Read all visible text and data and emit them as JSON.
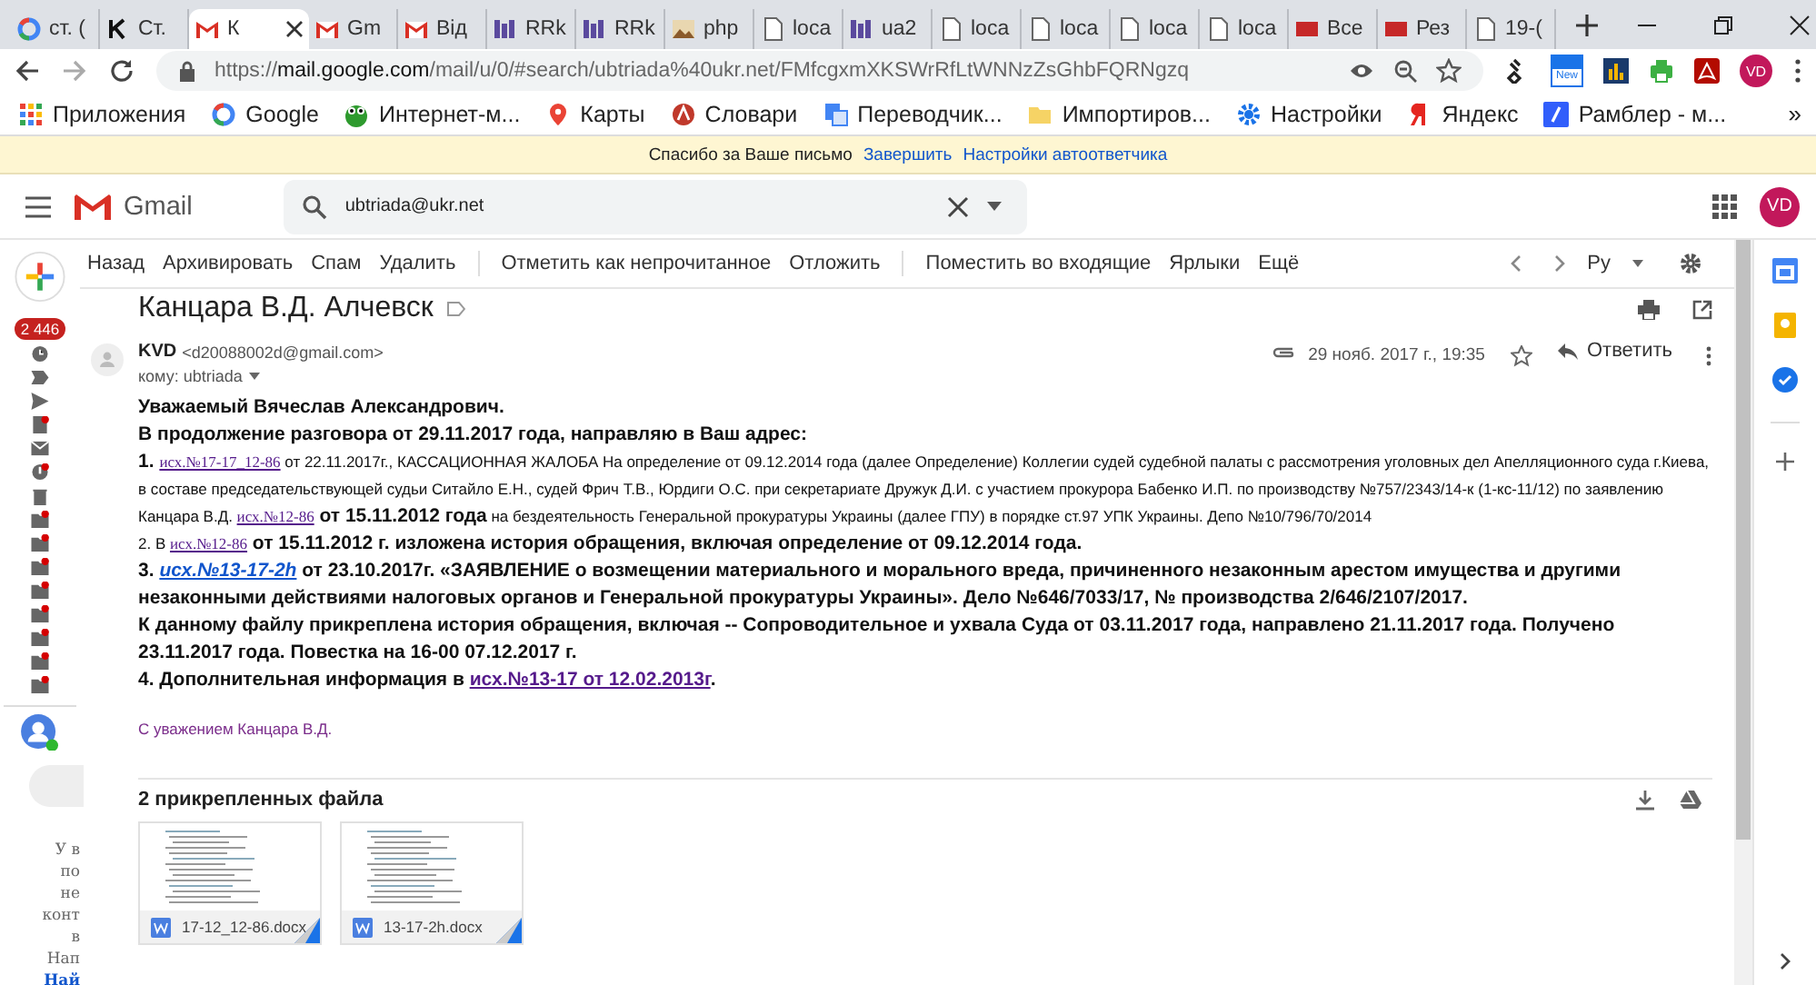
{
  "browser": {
    "tabs": [
      {
        "label": "ст. (",
        "kind": "google",
        "selected": false
      },
      {
        "label": "Ст.",
        "kind": "k",
        "selected": false
      },
      {
        "label": "К",
        "kind": "gmail",
        "selected": true
      },
      {
        "label": "Gm",
        "kind": "gmail",
        "selected": false
      },
      {
        "label": "Від",
        "kind": "gmail",
        "selected": false
      },
      {
        "label": "RRk",
        "kind": "rrk",
        "selected": false
      },
      {
        "label": "RRk",
        "kind": "rrk",
        "selected": false
      },
      {
        "label": "php",
        "kind": "php",
        "selected": false
      },
      {
        "label": "loca",
        "kind": "page",
        "selected": false
      },
      {
        "label": "ua2",
        "kind": "rrk",
        "selected": false
      },
      {
        "label": "loca",
        "kind": "page",
        "selected": false
      },
      {
        "label": "loca",
        "kind": "page",
        "selected": false
      },
      {
        "label": "loca",
        "kind": "page",
        "selected": false
      },
      {
        "label": "loca",
        "kind": "page",
        "selected": false
      },
      {
        "label": "Все",
        "kind": "cn",
        "selected": false
      },
      {
        "label": "Рез",
        "kind": "cn",
        "selected": false
      },
      {
        "label": "19-(",
        "kind": "page",
        "selected": false
      }
    ],
    "url": {
      "scheme": "https://",
      "host": "mail.google.com",
      "path": "/mail/u/0/#search/ubtriada%40ukr.net/FMfcgxmXKSWrRfLtWNNzZsGhbFQRNgzq"
    },
    "extension_badge": "New",
    "avatar_initials": "VD",
    "bookmarks": [
      {
        "label": "Приложения",
        "kind": "apps"
      },
      {
        "label": "Google",
        "kind": "google"
      },
      {
        "label": "Интернет-м...",
        "kind": "frog"
      },
      {
        "label": "Карты",
        "kind": "pin"
      },
      {
        "label": "Словари",
        "kind": "dict"
      },
      {
        "label": "Переводчик...",
        "kind": "translate"
      },
      {
        "label": "Импортиров...",
        "kind": "folder"
      },
      {
        "label": "Настройки",
        "kind": "gear"
      },
      {
        "label": "Яндекс",
        "kind": "yandex"
      },
      {
        "label": "Рамблер - м...",
        "kind": "rambler"
      }
    ],
    "bookmarks_overflow": "»"
  },
  "notice": {
    "text": "Спасибо за Ваше письмо",
    "links": [
      "Завершить",
      "Настройки автоответчика"
    ]
  },
  "gmail": {
    "product": "Gmail",
    "search_value": "ubtriada@ukr.net",
    "avatar_initials": "VD"
  },
  "toolbar": {
    "actions": [
      {
        "label": "Назад",
        "separator_before": false
      },
      {
        "label": "Архивировать",
        "separator_before": false
      },
      {
        "label": "Спам",
        "separator_before": false
      },
      {
        "label": "Удалить",
        "separator_before": false
      },
      {
        "label": "Отметить как непрочитанное",
        "separator_before": true
      },
      {
        "label": "Отложить",
        "separator_before": false
      },
      {
        "label": "Поместить во входящие",
        "separator_before": true
      },
      {
        "label": "Ярлыки",
        "separator_before": false
      },
      {
        "label": "Ещё",
        "separator_before": false
      }
    ],
    "language": "Ру"
  },
  "left_rail": {
    "unread_count": "2 446",
    "hangouts_text": [
      "У в",
      "по",
      "не",
      "конт",
      "в",
      "Нап",
      "Най"
    ]
  },
  "message": {
    "subject": "Канцара В.Д. Алчевск",
    "sender_name": "KVD",
    "sender_email": "<d20088002d@gmail.com>",
    "recipient": "кому: ubtriada",
    "date": "29 нояб. 2017 г., 19:35",
    "starred": false,
    "reply": "Ответить",
    "body": [
      [
        {
          "kind": "bold",
          "text": "Уважаемый Вячеслав Александрович."
        }
      ],
      [
        {
          "kind": "bold",
          "text": "В продолжение разговора от 29.11.2017 года, направляю в Ваш адрес:"
        }
      ],
      [
        {
          "kind": "bold",
          "text": "1. "
        },
        {
          "kind": "small-link",
          "text": "исх.№17-17_12-86"
        },
        {
          "kind": "small",
          "text": " от 22.11.2017г.,  КАССАЦИОННАЯ ЖАЛОБА На определение от 09.12.2014 года (далее Определение) Коллегии судей судебной палаты с рассмотрения уголовных дел Апелляционного суда г.Киева, в составе председательствующей судьи Ситайло Е.Н., судей Фрич Т.В., Юрдиги О.С. при секретариате Дружук Д.И. с участием прокурора Бабенко И.П. по производству №757/2343/14-к (1-кс-11/12) по заявлению Канцара В.Д. "
        },
        {
          "kind": "small-link",
          "text": "исх.№12-86"
        },
        {
          "kind": "bold",
          "text": " от 15.11.2012 года"
        },
        {
          "kind": "small",
          "text": " на бездеятельность Генеральной прокуратуры Украины (далее ГПУ) в порядке ст.97 УПК Украины. Депо №10/796/70/2014"
        }
      ],
      [
        {
          "kind": "small",
          "text": "2. В "
        },
        {
          "kind": "small-link",
          "text": "исх.№12-86"
        },
        {
          "kind": "bold",
          "text": " от 15.11.2012 г. изложена история обращения, включая определение от 09.12.2014 года."
        }
      ],
      [
        {
          "kind": "bold",
          "text": "3. "
        },
        {
          "kind": "italic-link",
          "text": "исх.№13-17-2h"
        },
        {
          "kind": "bold",
          "text": " от 23.10.2017г. «ЗАЯВЛЕНИЕ о возмещении материального и морального вреда, причиненного незаконным арестом имущества и другими незаконными действиями налоговых органов и Генеральной прокуратуры Украины». Дело №646/7033/17, № производства 2/646/2107/2017."
        }
      ],
      [
        {
          "kind": "bold",
          "text": "К данному файлу прикреплена история обращения, включая  -- Сопроводительное и ухвала Суда от 03.11.2017 года, направлено 21.11.2017 года. Получено 23.11.2017 года. Повестка на 16-00 07.12.2017 г."
        }
      ],
      [
        {
          "kind": "bold",
          "text": "4. Дополнительная информация в "
        },
        {
          "kind": "link",
          "text": "исх.№13-17 от 12.02.2013г"
        },
        {
          "kind": "bold",
          "text": "."
        }
      ]
    ],
    "signature": "С уважением Канцара В.Д.",
    "attachments_title": "2 прикрепленных файла",
    "attachments": [
      {
        "name": "17-12_12-86.docx"
      },
      {
        "name": "13-17-2h.docx"
      }
    ]
  }
}
